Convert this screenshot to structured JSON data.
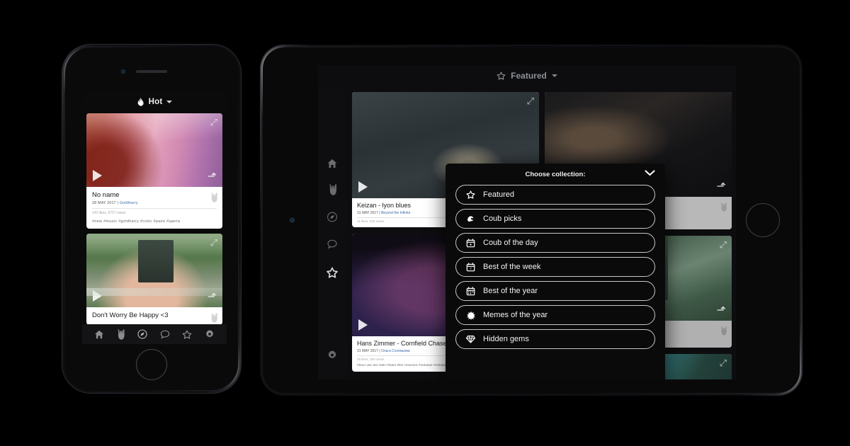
{
  "phone": {
    "header": {
      "icon": "flame-icon",
      "label": "Hot",
      "caret": "▾"
    },
    "cards": [
      {
        "title": "No name",
        "date": "28 MAY 2017",
        "separator": "|",
        "author": "GoldHarry",
        "stats": "142 likes, 5757 views",
        "tags": "#new  #music  #goldharry  #color  #paint  #цвета"
      },
      {
        "title": "Don't Worry Be Happy <3",
        "date": "",
        "separator": "",
        "author": "",
        "stats": "",
        "tags": ""
      }
    ],
    "nav": [
      {
        "name": "home-icon",
        "glyph": "⌂"
      },
      {
        "name": "rock-hand-icon",
        "glyph": "🤘"
      },
      {
        "name": "compass-icon",
        "glyph": "⦿"
      },
      {
        "name": "chat-bubble-icon",
        "glyph": "◯"
      },
      {
        "name": "star-icon",
        "glyph": "☆"
      },
      {
        "name": "gear-icon",
        "glyph": "⚙"
      }
    ]
  },
  "tablet": {
    "topbar": {
      "icon": "star-icon",
      "label": "Featured",
      "caret": "▾"
    },
    "sidebar": [
      {
        "name": "home-icon",
        "glyph": "⌂",
        "active": false
      },
      {
        "name": "rock-hand-icon",
        "glyph": "🤘",
        "active": false
      },
      {
        "name": "compass-icon",
        "glyph": "⦿",
        "active": false
      },
      {
        "name": "chat-bubble-icon",
        "glyph": "◯",
        "active": false
      },
      {
        "name": "star-icon",
        "glyph": "☆",
        "active": true
      },
      {
        "name": "gear-icon",
        "glyph": "⚙",
        "active": false
      }
    ],
    "cards": [
      {
        "title": "Keizan - lyon blues",
        "date": "31 MAY 2017",
        "separator": "|",
        "author": "Beyond the Infinite",
        "stats": "11 likes, 336 views",
        "tags": ""
      },
      {
        "title": "Hans Zimmer - Cornfield Chase",
        "date": "31 MAY 2017",
        "separator": "|",
        "author": "Ольга Соловьева",
        "stats": "28 likes, 306 views",
        "tags": "#teun van der zalm  #stars  #lee rosevere  #nebulae  #nebula"
      }
    ],
    "modal": {
      "title": "Choose collection:",
      "close_icon": "chevron-down-icon",
      "close_glyph": "⌄",
      "items": [
        {
          "label": "Featured",
          "icon": "star-icon"
        },
        {
          "label": "Coub picks",
          "icon": "hand-pick-icon"
        },
        {
          "label": "Coub of the day",
          "icon": "calendar-day-icon"
        },
        {
          "label": "Best of the week",
          "icon": "calendar-week-icon"
        },
        {
          "label": "Best of the year",
          "icon": "calendar-year-icon"
        },
        {
          "label": "Memes of the year",
          "icon": "meme-burst-icon"
        },
        {
          "label": "Hidden gems",
          "icon": "gem-icon"
        }
      ]
    }
  },
  "colors": {
    "background": "#000000",
    "screen_bg": "#0d0d0f",
    "modal_bg": "#0a0a0b",
    "pill_border": "#c7c7c7",
    "text_primary": "#f2f2f2",
    "author_link": "#3a6ea8"
  }
}
